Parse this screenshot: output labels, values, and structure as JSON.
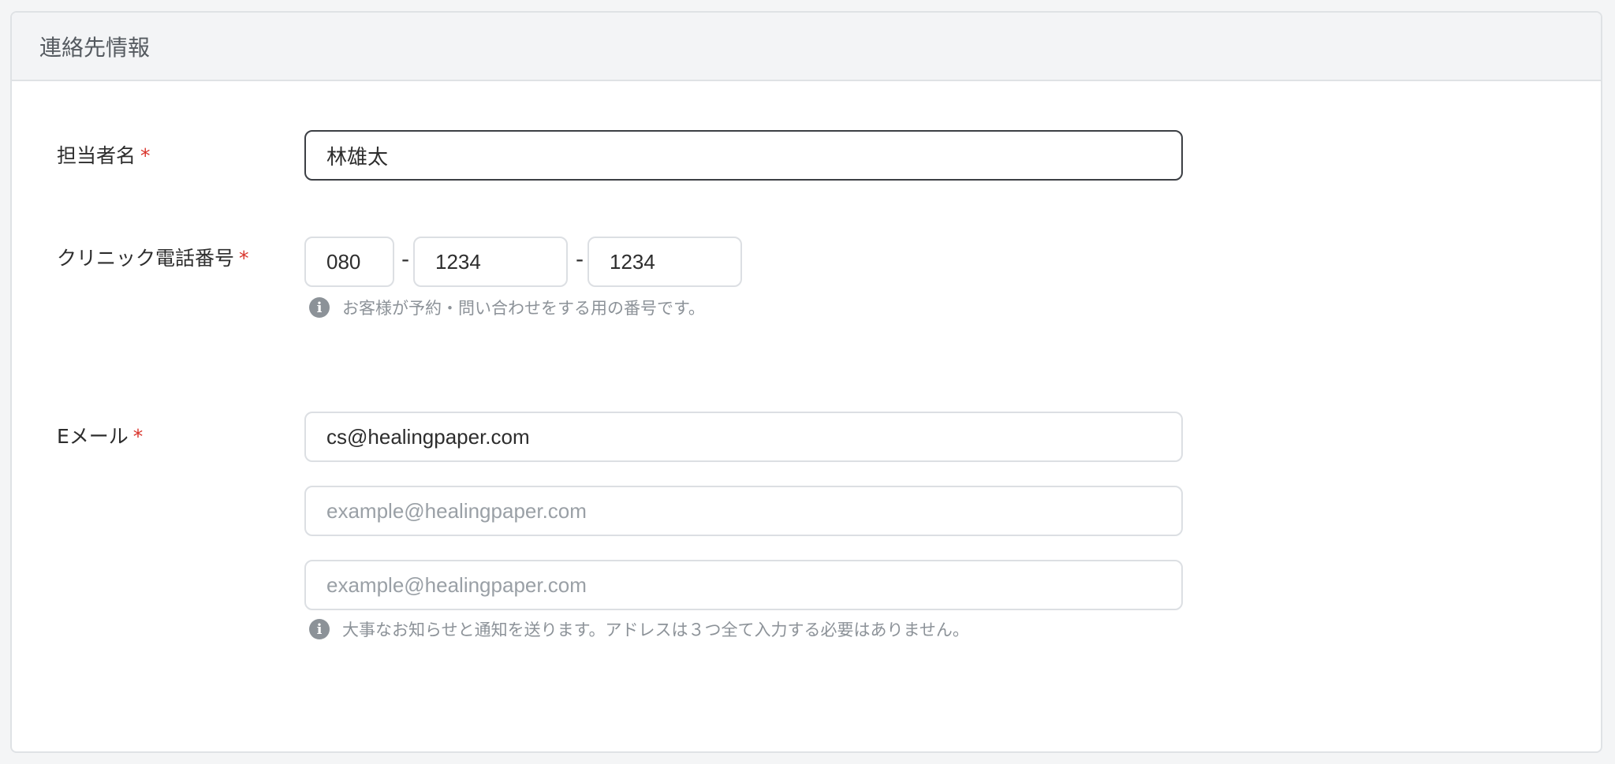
{
  "section": {
    "title": "連絡先情報"
  },
  "contact_name": {
    "label": "担当者名",
    "required_mark": "*",
    "value": "林雄太"
  },
  "clinic_phone": {
    "label": "クリニック電話番号",
    "required_mark": "*",
    "part1": "080",
    "part2": "1234",
    "part3": "1234",
    "separator": "-",
    "hint": "お客様が予約・問い合わせをする用の番号です。"
  },
  "email": {
    "label": "Eメール",
    "required_mark": "*",
    "email1_value": "cs@healingpaper.com",
    "email2_placeholder": "example@healingpaper.com",
    "email3_placeholder": "example@healingpaper.com",
    "hint": "大事なお知らせと通知を送ります。アドレスは３つ全て入力する必要はありません。"
  },
  "icons": {
    "info": "i"
  },
  "colors": {
    "required": "#d9342b",
    "hint_text": "#8c9298",
    "border": "#dcdfe3",
    "focus_border": "#3c3f44"
  }
}
